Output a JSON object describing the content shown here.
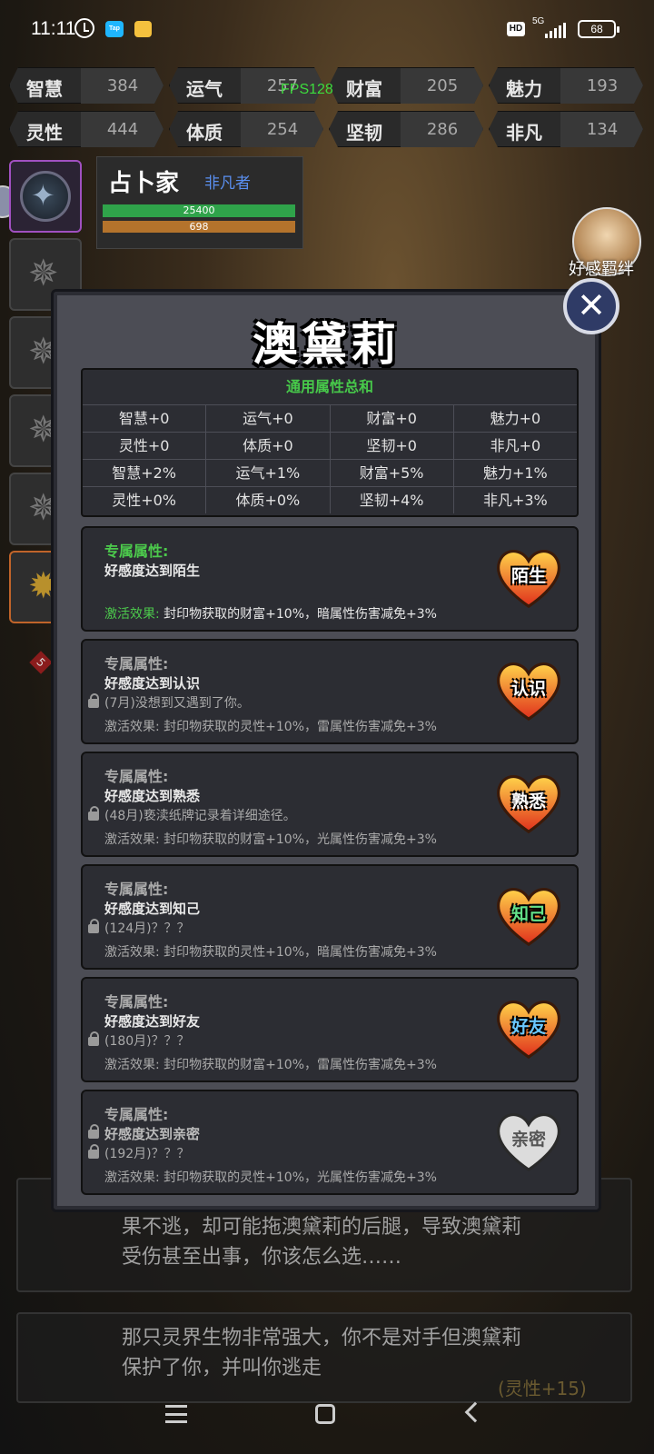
{
  "status_bar": {
    "time": "11:11",
    "tap_label": "Tap",
    "hd": "HD",
    "network": "5G",
    "battery": "68"
  },
  "fps": "FPS128",
  "stats": [
    {
      "name": "智慧",
      "value": "384"
    },
    {
      "name": "运气",
      "value": "257"
    },
    {
      "name": "财富",
      "value": "205"
    },
    {
      "name": "魅力",
      "value": "193"
    },
    {
      "name": "灵性",
      "value": "444"
    },
    {
      "name": "体质",
      "value": "254"
    },
    {
      "name": "坚韧",
      "value": "286"
    },
    {
      "name": "非凡",
      "value": "134"
    }
  ],
  "character": {
    "title": "占卜家",
    "rank": "非凡者",
    "hp": "25400",
    "mp": "698"
  },
  "favor": {
    "label": "好感羁绊"
  },
  "modal": {
    "title": "澳黛莉",
    "attr_header": "通用属性总和",
    "attr_rows": [
      [
        "智慧+0",
        "运气+0",
        "财富+0",
        "魅力+0"
      ],
      [
        "灵性+0",
        "体质+0",
        "坚韧+0",
        "非凡+0"
      ],
      [
        "智慧+2%",
        "运气+1%",
        "财富+5%",
        "魅力+1%"
      ],
      [
        "灵性+0%",
        "体质+0%",
        "坚韧+4%",
        "非凡+3%"
      ]
    ],
    "cards": [
      {
        "label": "专属属性:",
        "condition": "好感度达到陌生",
        "story": "",
        "effect_label": "激活效果:",
        "effect": "封印物获取的财富+10%，暗属性伤害减免+3%",
        "badge": "陌生",
        "active": true
      },
      {
        "label": "专属属性:",
        "condition": "好感度达到认识",
        "story": "(7月)没想到又遇到了你。",
        "effect_label": "激活效果:",
        "effect": "封印物获取的灵性+10%，雷属性伤害减免+3%",
        "badge": "认识",
        "active": false
      },
      {
        "label": "专属属性:",
        "condition": "好感度达到熟悉",
        "story": "(48月)亵渎纸牌记录着详细途径。",
        "effect_label": "激活效果:",
        "effect": "封印物获取的财富+10%，光属性伤害减免+3%",
        "badge": "熟悉",
        "active": false
      },
      {
        "label": "专属属性:",
        "condition": "好感度达到知己",
        "story": "(124月)？？？",
        "effect_label": "激活效果:",
        "effect": "封印物获取的灵性+10%，暗属性伤害减免+3%",
        "badge": "知己",
        "active": false
      },
      {
        "label": "专属属性:",
        "condition": "好感度达到好友",
        "story": "(180月)？？？",
        "effect_label": "激活效果:",
        "effect": "封印物获取的财富+10%，雷属性伤害减免+3%",
        "badge": "好友",
        "active": false
      },
      {
        "label": "专属属性:",
        "condition": "好感度达到亲密",
        "story": "(192月)？？？",
        "effect_label": "激活效果:",
        "effect": "封印物获取的灵性+10%，光属性伤害减免+3%",
        "badge": "亲密",
        "active": false
      }
    ]
  },
  "background_story": {
    "para1_line1": "果不逃，却可能拖澳黛莉的后腿，导致澳黛莉",
    "para1_line2": "受伤甚至出事，你该怎么选……",
    "para2_line1": "那只灵界生物非常强大，你不是对手但澳黛莉",
    "para2_line2": "保护了你，并叫你逃走",
    "hint": "(灵性+15)",
    "side_badge": "5"
  },
  "colors": {
    "green": "#47c84a",
    "heart_red": "#e03a2a",
    "heart_orange": "#f5a623",
    "heart_gray": "#d9d9d9"
  }
}
